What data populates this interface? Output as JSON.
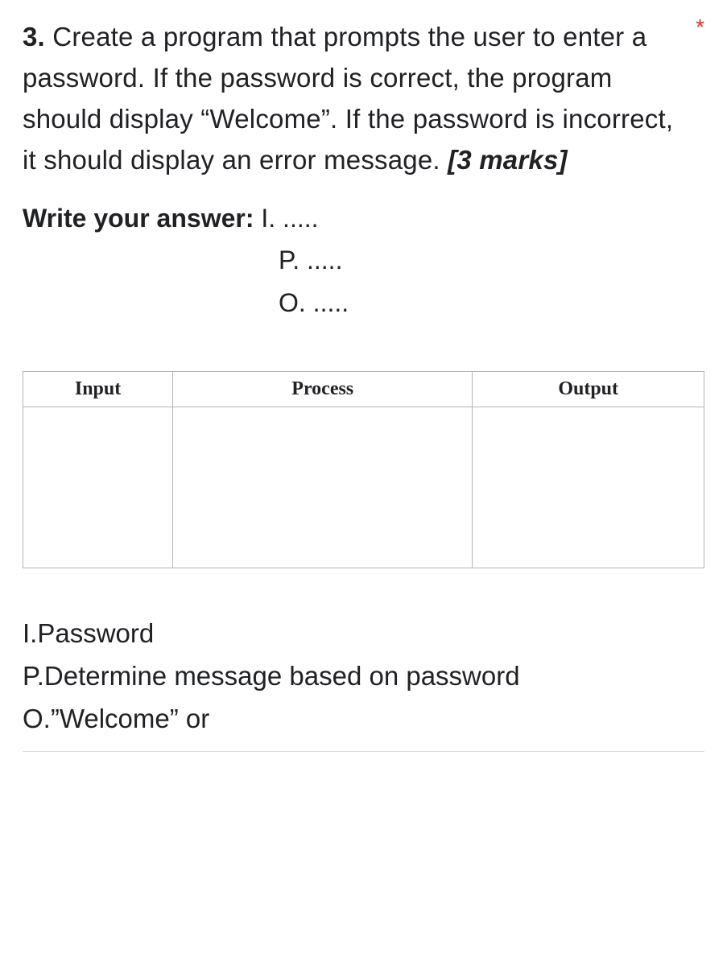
{
  "question": {
    "number": "3.",
    "text": " Create a program that prompts the user to enter a password. If the password is correct, the program should display “Welcome”. If the password is incorrect, it should display an error message. ",
    "marks": "[3 marks]",
    "required_indicator": "*"
  },
  "answer_prompt": {
    "label": "Write your answer: ",
    "lines": {
      "i": "I. .....",
      "p": "P. .....",
      "o": "O. ....."
    }
  },
  "table": {
    "headers": {
      "input": "Input",
      "process": "Process",
      "output": "Output"
    },
    "cells": {
      "input": "",
      "process": "",
      "output": ""
    }
  },
  "bottom": {
    "line_i": "I.Password",
    "line_p": "P.Determine message based on password",
    "line_o": "O.”Welcome” or"
  }
}
